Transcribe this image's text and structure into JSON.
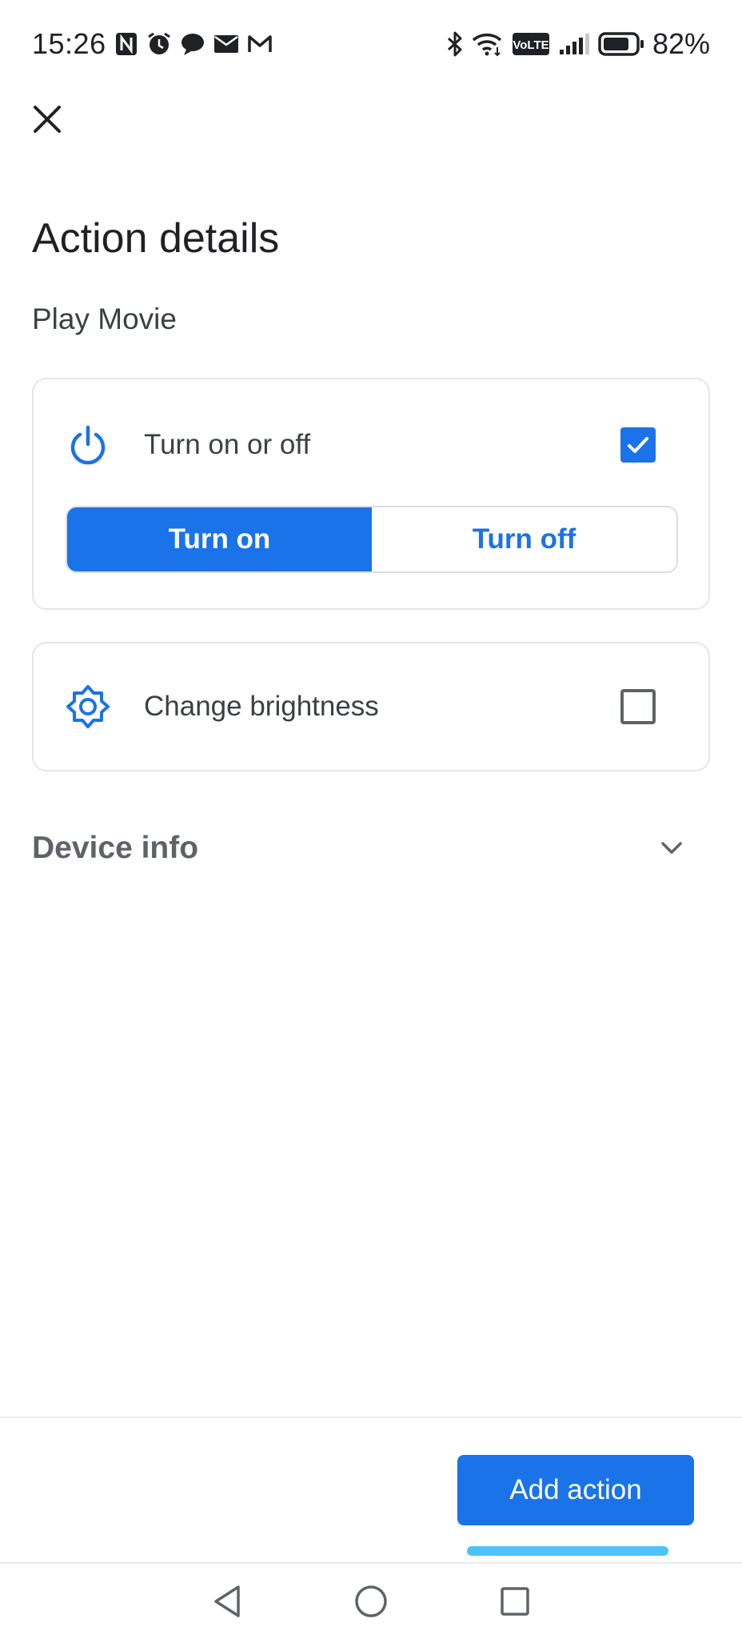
{
  "status_bar": {
    "time": "15:26",
    "battery_percent": "82%",
    "left_icons": [
      "nfc-icon",
      "alarm-icon",
      "chat-icon",
      "mail-icon",
      "gmail-icon"
    ],
    "right_icons": [
      "bluetooth-icon",
      "wifi-icon",
      "volte-icon",
      "signal-icon",
      "battery-icon"
    ],
    "volte_label": "VoLTE",
    "battery_level": 0.82
  },
  "header": {
    "title": "Action details",
    "subtitle": "Play Movie"
  },
  "actions": {
    "power": {
      "icon": "power-icon",
      "label": "Turn on or off",
      "checked": true,
      "options": {
        "on_label": "Turn on",
        "off_label": "Turn off",
        "selected": "Turn on"
      }
    },
    "brightness": {
      "icon": "brightness-icon",
      "label": "Change brightness",
      "checked": false
    }
  },
  "device_info": {
    "label": "Device info",
    "expanded": false
  },
  "footer": {
    "add_action_label": "Add action"
  },
  "colors": {
    "accent": "#1a73e8",
    "text_primary": "#202124",
    "text_secondary": "#5f6368",
    "gesture_bar": "#4fc3f7"
  }
}
